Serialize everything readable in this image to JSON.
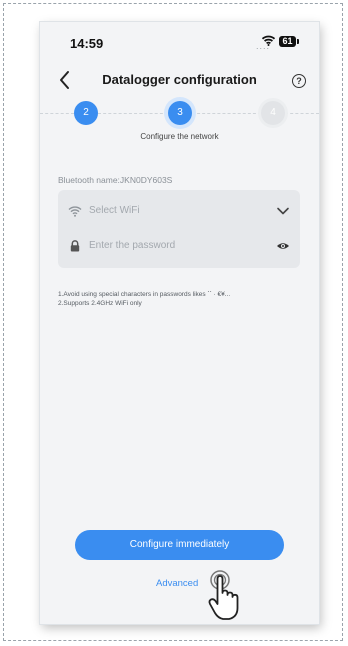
{
  "status_bar": {
    "time": "14:59",
    "signal": "....",
    "battery": "61"
  },
  "nav": {
    "title": "Datalogger configuration",
    "help": "?"
  },
  "stepper": {
    "steps": [
      "2",
      "3",
      "4"
    ],
    "active_label": "Configure the network"
  },
  "form": {
    "bluetooth_name": "Bluetooth name:JKN0DY603S",
    "wifi_placeholder": "Select WiFi",
    "password_placeholder": "Enter the password"
  },
  "tips": [
    "1.Avoid using special characters in passwords likes ˋˋ · €¥...",
    "2.Supports 2.4GHz WiFi only"
  ],
  "actions": {
    "primary": "Configure immediately",
    "advanced": "Advanced"
  },
  "colors": {
    "accent": "#3a8df0",
    "card": "#e6e8eb",
    "background": "#f3f4f6"
  }
}
